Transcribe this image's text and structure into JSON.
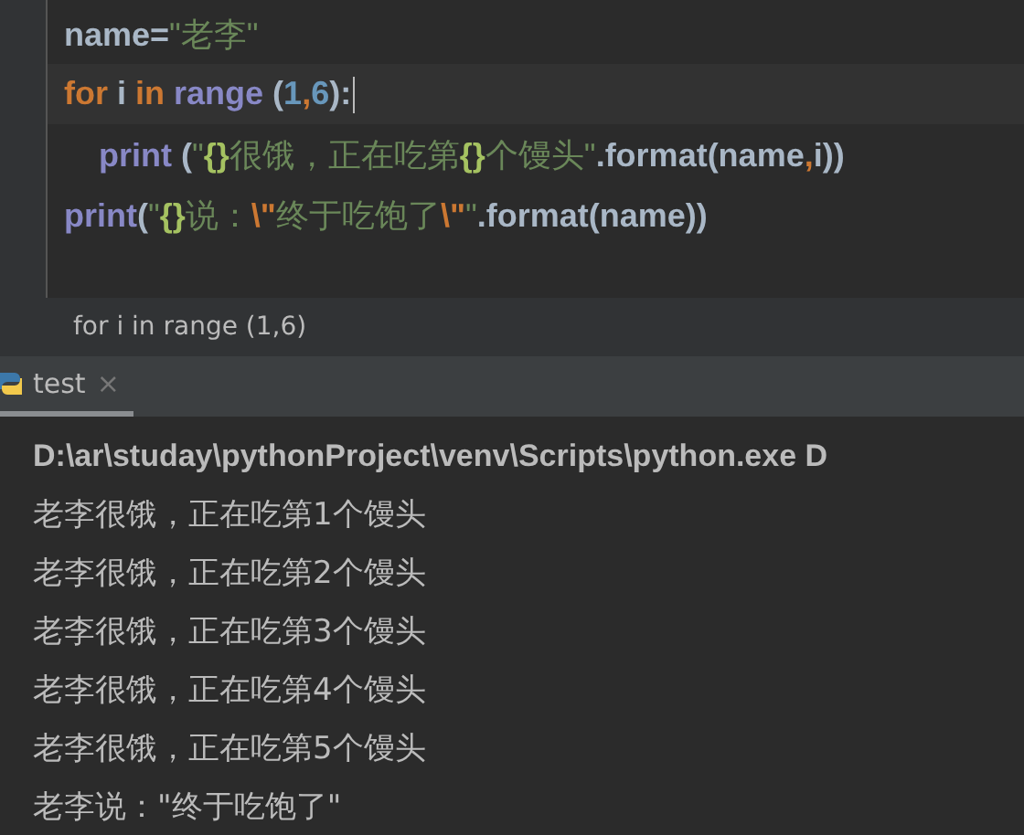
{
  "editor": {
    "lines": [
      {
        "current": false,
        "tokens": [
          {
            "kind": "plain",
            "text": "name="
          },
          {
            "kind": "string",
            "text": "\"老李\""
          }
        ]
      },
      {
        "current": true,
        "tokens": [
          {
            "kind": "keyword",
            "text": "for"
          },
          {
            "kind": "plain",
            "text": " i "
          },
          {
            "kind": "keyword",
            "text": "in "
          },
          {
            "kind": "builtin",
            "text": "range"
          },
          {
            "kind": "plain",
            "text": " ("
          },
          {
            "kind": "number",
            "text": "1"
          },
          {
            "kind": "keyword",
            "text": ","
          },
          {
            "kind": "number",
            "text": "6"
          },
          {
            "kind": "plain",
            "text": "):"
          }
        ]
      },
      {
        "current": false,
        "indent": true,
        "tokens": [
          {
            "kind": "builtin",
            "text": "print"
          },
          {
            "kind": "plain",
            "text": " ("
          },
          {
            "kind": "string",
            "text": "\""
          },
          {
            "kind": "format",
            "text": "{}"
          },
          {
            "kind": "string",
            "text": "很饿，正在吃第"
          },
          {
            "kind": "format",
            "text": "{}"
          },
          {
            "kind": "string",
            "text": "个馒头\""
          },
          {
            "kind": "plain",
            "text": ".format(name"
          },
          {
            "kind": "keyword",
            "text": ","
          },
          {
            "kind": "plain",
            "text": "i))"
          }
        ]
      },
      {
        "current": false,
        "tokens": [
          {
            "kind": "builtin",
            "text": "print"
          },
          {
            "kind": "plain",
            "text": "("
          },
          {
            "kind": "string",
            "text": "\""
          },
          {
            "kind": "format",
            "text": "{}"
          },
          {
            "kind": "string",
            "text": "说："
          },
          {
            "kind": "escape",
            "text": "\\\""
          },
          {
            "kind": "string",
            "text": "终于吃饱了"
          },
          {
            "kind": "escape",
            "text": "\\\""
          },
          {
            "kind": "string",
            "text": "\""
          },
          {
            "kind": "plain",
            "text": ".format(name))"
          }
        ]
      }
    ]
  },
  "breadcrumb": "for i in range (1,6)",
  "run_tabs": [
    {
      "label": "test",
      "selected": true,
      "close": "×"
    }
  ],
  "console": {
    "command": "D:\\ar\\studay\\pythonProject\\venv\\Scripts\\python.exe D",
    "output": [
      "老李很饿，正在吃第1个馒头",
      "老李很饿，正在吃第2个馒头",
      "老李很饿，正在吃第3个馒头",
      "老李很饿，正在吃第4个馒头",
      "老李很饿，正在吃第5个馒头",
      "老李说：\"终于吃饱了\""
    ]
  }
}
